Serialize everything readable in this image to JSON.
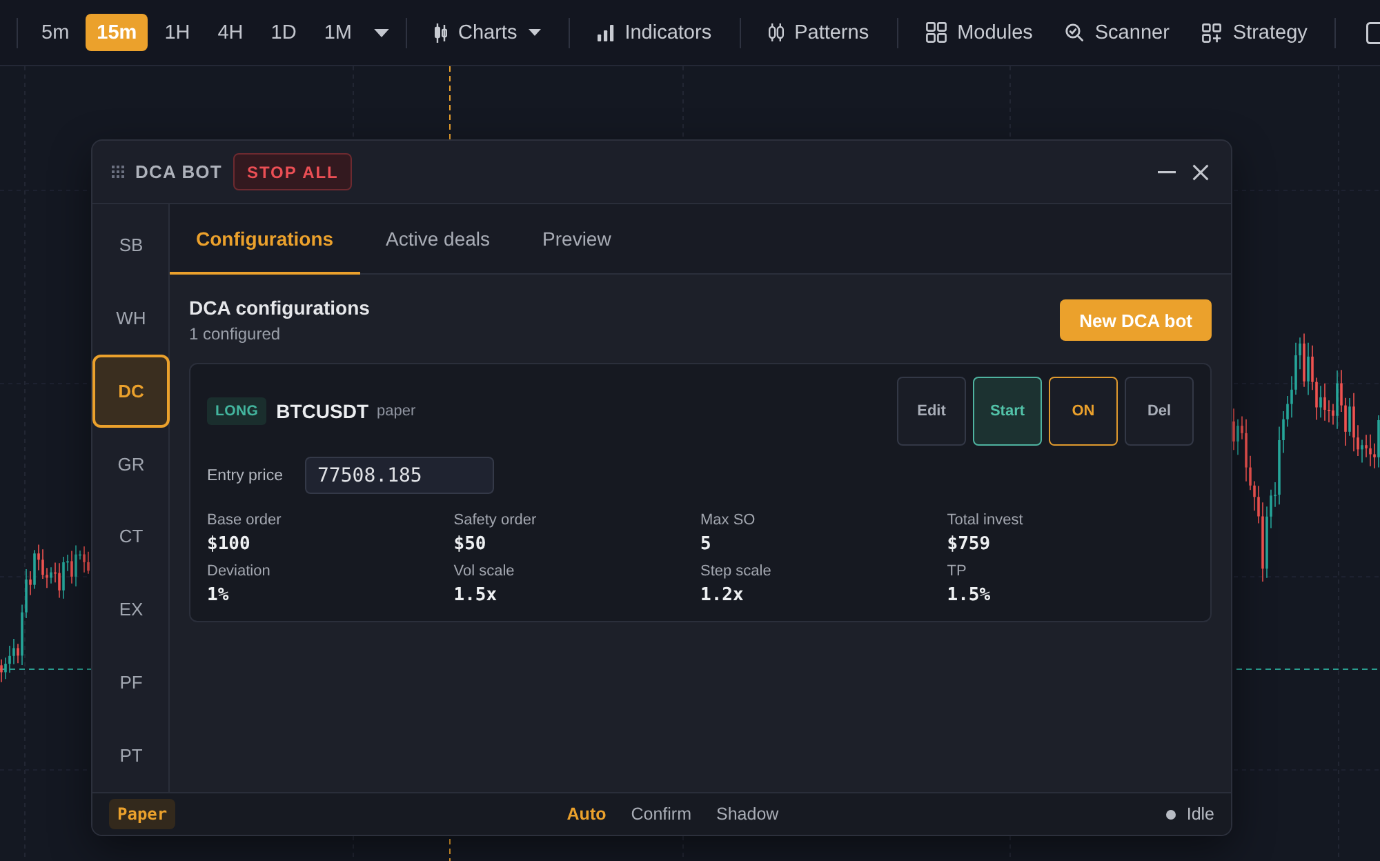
{
  "toolbar": {
    "timeframes": [
      {
        "label": "5m",
        "selected": false
      },
      {
        "label": "15m",
        "selected": true
      },
      {
        "label": "1H",
        "selected": false
      },
      {
        "label": "4H",
        "selected": false
      },
      {
        "label": "1D",
        "selected": false
      },
      {
        "label": "1M",
        "selected": false
      }
    ],
    "menu_groups": [
      {
        "items": [
          {
            "label": "Charts",
            "dropdown": true
          }
        ]
      },
      {
        "items": [
          {
            "label": "Indicators",
            "dropdown": false
          }
        ]
      },
      {
        "items": [
          {
            "label": "Patterns",
            "dropdown": false
          }
        ]
      },
      {
        "items": [
          {
            "label": "Modules",
            "dropdown": false
          },
          {
            "label": "Scanner",
            "dropdown": false
          },
          {
            "label": "Strategy",
            "dropdown": false
          }
        ]
      }
    ]
  },
  "dca_window": {
    "title": "DCA BOT",
    "stop_all_button": "STOP ALL",
    "sidebar": [
      {
        "label": "SB",
        "selected": false
      },
      {
        "label": "WH",
        "selected": false
      },
      {
        "label": "DC",
        "selected": true
      },
      {
        "label": "GR",
        "selected": false
      },
      {
        "label": "CT",
        "selected": false
      },
      {
        "label": "EX",
        "selected": false
      },
      {
        "label": "PF",
        "selected": false
      },
      {
        "label": "PT",
        "selected": false
      }
    ],
    "tabs": [
      {
        "label": "Configurations",
        "selected": true
      },
      {
        "label": "Active deals",
        "selected": false
      },
      {
        "label": "Preview",
        "selected": false
      }
    ],
    "configurations": {
      "title": "DCA configurations",
      "count": "1 configured",
      "new_button": "New DCA bot",
      "bots": [
        {
          "side": {
            "label": "LONG",
            "kind": "long"
          },
          "symbol": "BTCUSDT",
          "mode": "paper",
          "actions": [
            {
              "label": "Edit",
              "kind": "plain"
            },
            {
              "label": "Start",
              "kind": "start"
            },
            {
              "label": "ON",
              "kind": "toggle"
            },
            {
              "label": "Del",
              "kind": "plain"
            }
          ],
          "entry_price": {
            "label": "Entry price",
            "value": "77508.185"
          },
          "stats": [
            {
              "label": "Base order",
              "value": "$100"
            },
            {
              "label": "Safety order",
              "value": "$50"
            },
            {
              "label": "Max SO",
              "value": "5"
            },
            {
              "label": "Total invest",
              "value": "$759"
            },
            {
              "label": "Deviation",
              "value": "1%"
            },
            {
              "label": "Vol scale",
              "value": "1.5x"
            },
            {
              "label": "Step scale",
              "value": "1.2x"
            },
            {
              "label": "TP",
              "value": "1.5%"
            }
          ]
        }
      ]
    },
    "footer": {
      "account": "Paper",
      "modes": [
        {
          "label": "Auto",
          "selected": true
        },
        {
          "label": "Confirm",
          "selected": false
        },
        {
          "label": "Shadow",
          "selected": false
        }
      ],
      "status": {
        "label": "Idle",
        "kind": "idle"
      }
    }
  }
}
